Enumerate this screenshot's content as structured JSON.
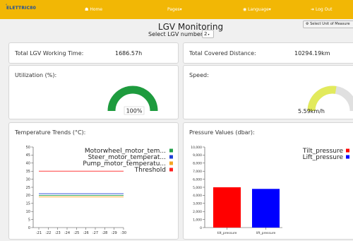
{
  "nav": {
    "logo": "ELETTRIC80",
    "home": "Home",
    "pages": "Pages",
    "language": "Language",
    "logout": "Log Out"
  },
  "header": {
    "title": "LGV Monitoring",
    "select_label": "Select LGV number",
    "selected_lgv": "2",
    "unit_button": "Select Unit of Measure"
  },
  "cards": {
    "working_time": {
      "label": "Total LGV Working Time:",
      "value": "1686.57h"
    },
    "distance": {
      "label": "Total Covered Distance:",
      "value": "10294.19km"
    },
    "utilization": {
      "label": "Utilization (%):",
      "value": "100%",
      "fraction": 1.0,
      "color": "#1e9b3e"
    },
    "speed": {
      "label": "Speed:",
      "value": "5.59km/h",
      "fraction": 0.55,
      "color": "#e2ea5c"
    },
    "temperature": {
      "label": "Temperature Trends (°C):"
    },
    "pressure": {
      "label": "Pressure Values (dbar):"
    }
  },
  "chart_data": [
    {
      "type": "line",
      "title": "",
      "x": [
        ":21",
        ":22",
        ":23",
        ":24",
        ":25",
        ":26",
        ":27",
        ":28",
        ":29",
        ":30"
      ],
      "ylim": [
        0,
        50
      ],
      "yticks": [
        0,
        5,
        10,
        15,
        20,
        25,
        30,
        35,
        40,
        45,
        50
      ],
      "series": [
        {
          "name": "Motorwheel_motor_tem...",
          "color": "#22a04a",
          "values": [
            20,
            20,
            20,
            20,
            20,
            20,
            20,
            20,
            20,
            20
          ]
        },
        {
          "name": "Steer_motor_temperat...",
          "color": "#1f3fd6",
          "values": [
            21,
            21,
            21,
            21,
            21,
            21,
            21,
            21,
            21,
            21
          ]
        },
        {
          "name": "Pump_motor_temperatu...",
          "color": "#f5a623",
          "values": [
            19,
            19,
            19,
            19,
            19,
            19,
            19,
            19,
            19,
            19
          ]
        },
        {
          "name": "Threshold",
          "color": "#ff2020",
          "values": [
            35,
            35,
            35,
            35,
            35,
            35,
            35,
            35,
            35,
            35
          ]
        }
      ],
      "legend": "top-right"
    },
    {
      "type": "bar",
      "title": "",
      "categories": [
        "tilt_pressure",
        "lift_pressure"
      ],
      "ylim": [
        0,
        10000
      ],
      "yticks": [
        "0",
        "1,000",
        "2,000",
        "3,000",
        "4,000",
        "5,000",
        "6,000",
        "7,000",
        "8,000",
        "9,000",
        "10,000"
      ],
      "series": [
        {
          "name": "Tilt_pressure",
          "color": "#ff0000",
          "values": [
            5000
          ]
        },
        {
          "name": "Lift_pressure",
          "color": "#0000ff",
          "values": [
            4800
          ]
        }
      ],
      "legend": "top-right"
    }
  ]
}
